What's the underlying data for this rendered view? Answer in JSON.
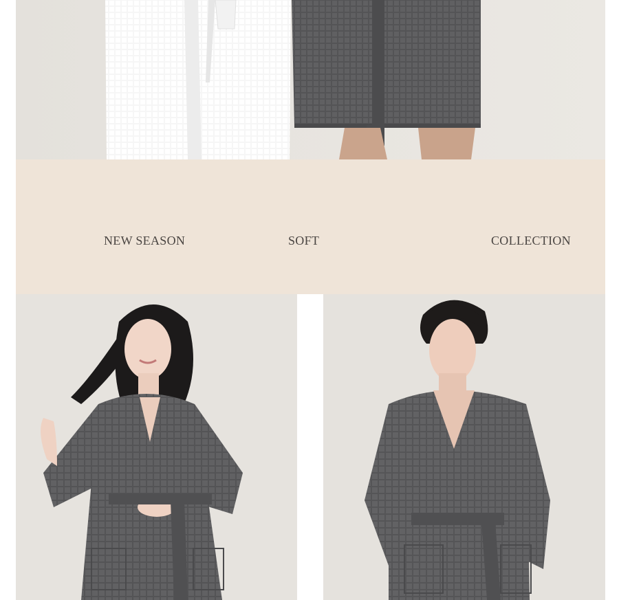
{
  "banner": {
    "word_1": "NEW SEASON",
    "word_2": "SOFT",
    "word_3": "COLLECTION"
  },
  "colors": {
    "banner_bg": "#efe4d8",
    "photo_bg": "#e6e3de",
    "robe_gray": "#5c5c5e",
    "robe_white": "#f7f7f7",
    "text": "#4a4542"
  }
}
